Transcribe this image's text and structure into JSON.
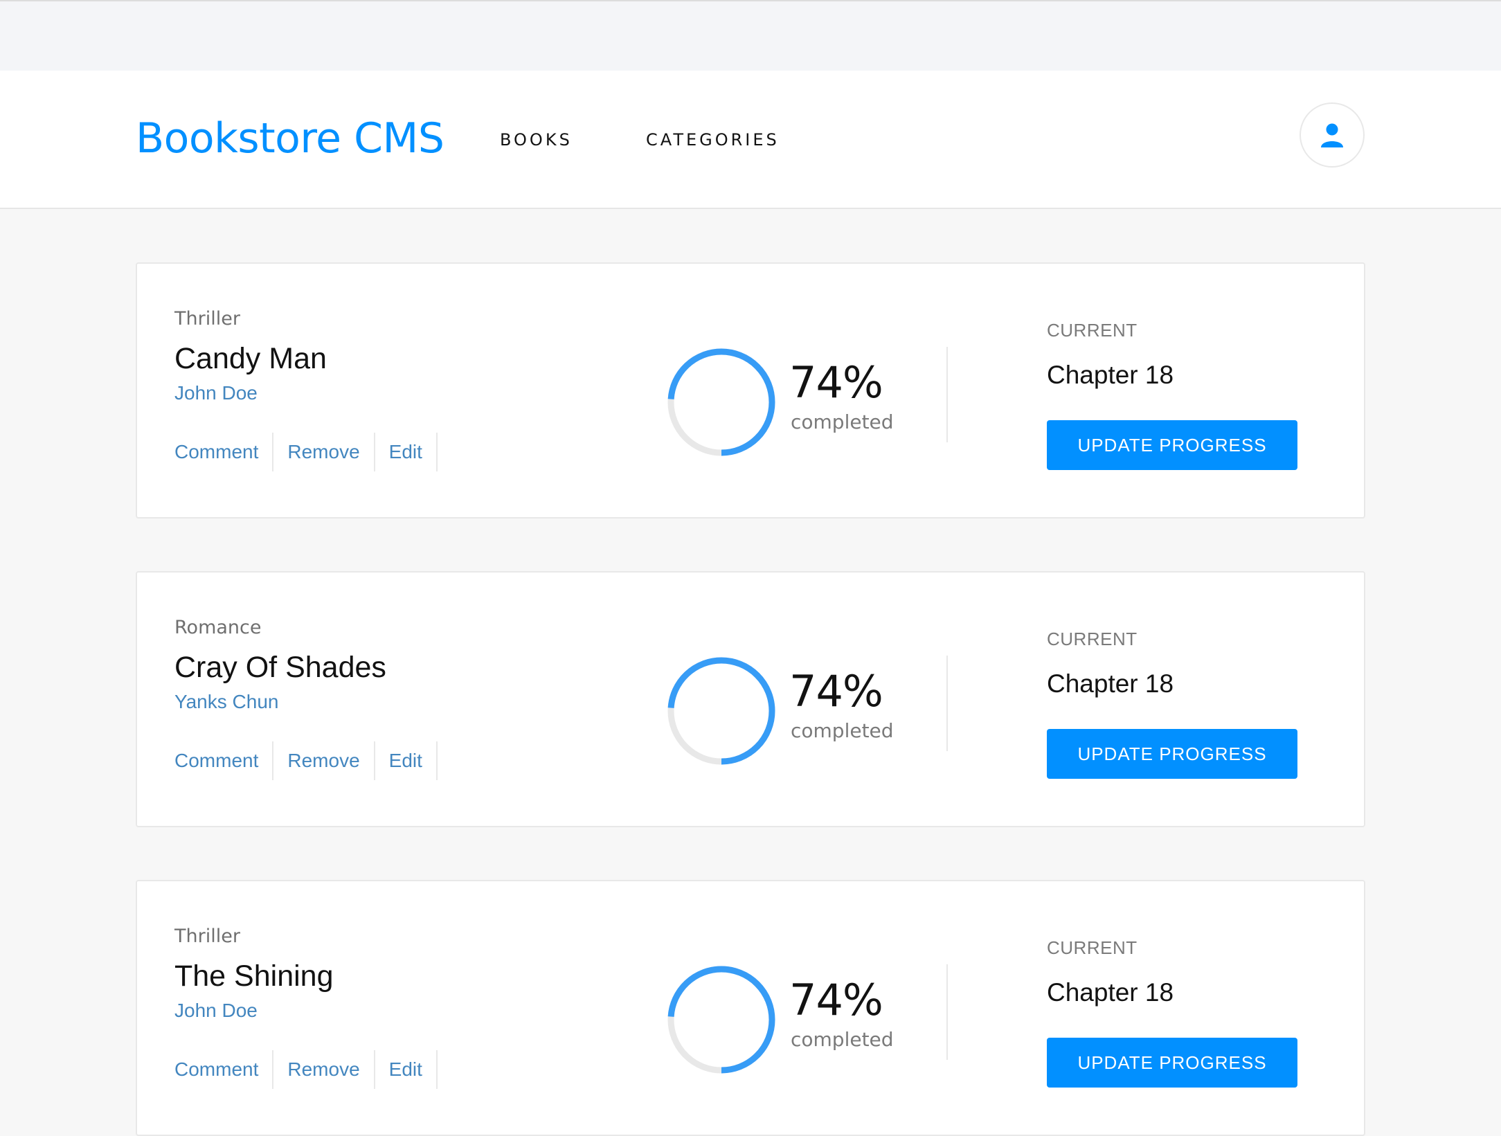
{
  "header": {
    "logo": "Bookstore CMS",
    "nav": [
      "BOOKS",
      "CATEGORIES"
    ],
    "user_icon": "user-icon"
  },
  "colors": {
    "primary": "#0290ff",
    "link": "#4386bf",
    "ring_track": "#e8e8e8",
    "ring_progress": "#379cf6"
  },
  "books": [
    {
      "genre": "Thriller",
      "title": "Candy Man",
      "author": "John Doe",
      "actions": [
        "Comment",
        "Remove",
        "Edit"
      ],
      "progress_percent": 74,
      "percent_label": "74%",
      "completed_label": "completed",
      "current_label": "CURRENT",
      "chapter": "Chapter 18",
      "button_label": "UPDATE PROGRESS"
    },
    {
      "genre": "Romance",
      "title": "Cray Of Shades",
      "author": "Yanks Chun",
      "actions": [
        "Comment",
        "Remove",
        "Edit"
      ],
      "progress_percent": 74,
      "percent_label": "74%",
      "completed_label": "completed",
      "current_label": "CURRENT",
      "chapter": "Chapter 18",
      "button_label": "UPDATE PROGRESS"
    },
    {
      "genre": "Thriller",
      "title": "The Shining",
      "author": "John Doe",
      "actions": [
        "Comment",
        "Remove",
        "Edit"
      ],
      "progress_percent": 74,
      "percent_label": "74%",
      "completed_label": "completed",
      "current_label": "CURRENT",
      "chapter": "Chapter 18",
      "button_label": "UPDATE PROGRESS"
    }
  ]
}
